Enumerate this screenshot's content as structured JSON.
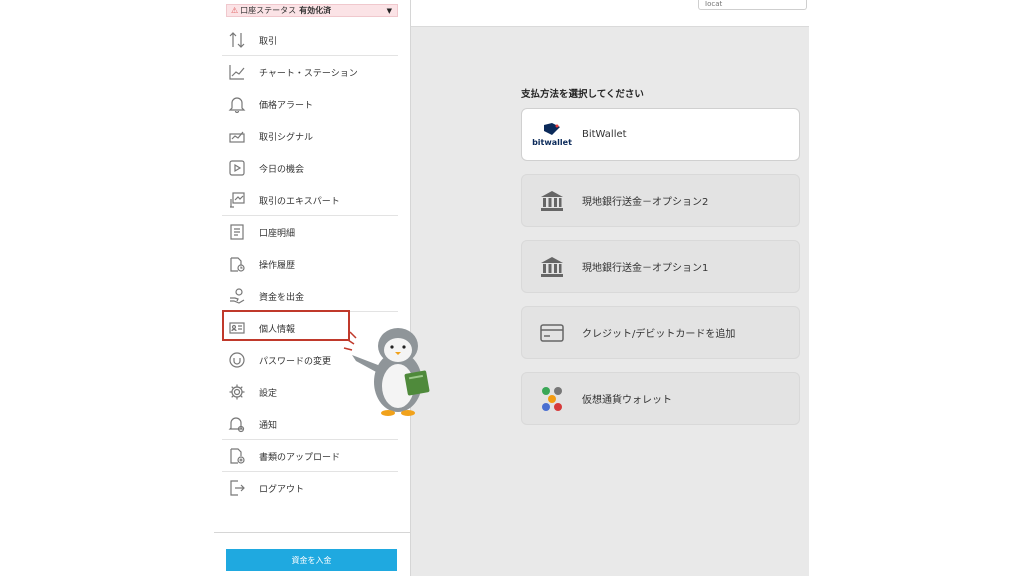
{
  "sidebar": {
    "status": {
      "label": "口座ステータス",
      "value": "有効化済"
    },
    "items": [
      {
        "label": "取引",
        "icon": "arrows-up-down-icon"
      },
      {
        "label": "チャート・ステーション",
        "icon": "line-chart-icon"
      },
      {
        "label": "価格アラート",
        "icon": "bell-icon"
      },
      {
        "label": "取引シグナル",
        "icon": "signal-icon"
      },
      {
        "label": "今日の機会",
        "icon": "play-icon"
      },
      {
        "label": "取引のエキスパート",
        "icon": "expert-icon"
      },
      {
        "label": "口座明細",
        "icon": "statement-icon"
      },
      {
        "label": "操作履歴",
        "icon": "history-icon"
      },
      {
        "label": "資金を出金",
        "icon": "withdraw-icon"
      },
      {
        "label": "個人情報",
        "icon": "id-card-icon"
      },
      {
        "label": "パスワードの変更",
        "icon": "password-icon"
      },
      {
        "label": "設定",
        "icon": "gear-icon"
      },
      {
        "label": "通知",
        "icon": "notification-icon"
      },
      {
        "label": "書類のアップロード",
        "icon": "upload-icon"
      },
      {
        "label": "ログアウト",
        "icon": "logout-icon"
      }
    ],
    "deposit_label": "資金を入金"
  },
  "main": {
    "top_input_placeholder": "Iocat",
    "title": "支払方法を選択してください",
    "options": [
      {
        "label": "BitWallet",
        "logo_text": "bitwallet",
        "icon": "bitwallet-logo"
      },
      {
        "label": "現地銀行送金－オプション2",
        "icon": "bank-icon"
      },
      {
        "label": "現地銀行送金－オプション1",
        "icon": "bank-icon"
      },
      {
        "label": "クレジット/デビットカードを追加",
        "icon": "credit-card-icon"
      },
      {
        "label": "仮想通貨ウォレット",
        "icon": "crypto-icon"
      }
    ]
  },
  "colors": {
    "accent": "#1fa9e0",
    "highlight": "#c0392b",
    "status_bg": "#fbe3e6"
  }
}
